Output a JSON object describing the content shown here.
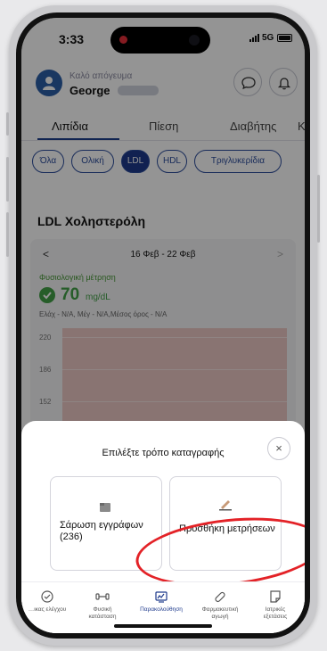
{
  "status_bar": {
    "time": "3:33",
    "network": "5G"
  },
  "header": {
    "greeting": "Καλό απόγευμα",
    "username": "George",
    "chat_icon": "chat-bubble-icon",
    "notifications_icon": "bell-icon"
  },
  "tabs": [
    {
      "label": "Λιπίδια",
      "active": true
    },
    {
      "label": "Πίεση",
      "active": false
    },
    {
      "label": "Διαβήτης",
      "active": false
    },
    {
      "label": "Κ",
      "active": false
    }
  ],
  "chips": [
    {
      "label": "Όλα",
      "active": false
    },
    {
      "label": "Ολική",
      "active": false
    },
    {
      "label": "LDL",
      "active": true
    },
    {
      "label": "HDL",
      "active": false
    },
    {
      "label": "Τριγλυκερίδια",
      "active": false
    }
  ],
  "section_title": "LDL Χοληστερόλη",
  "chart_card": {
    "prev": "<",
    "next": ">",
    "week_label": "16 Φεβ - 22 Φεβ",
    "status": "Φυσιολογική μέτρηση",
    "value": "70",
    "unit": "mg/dL",
    "stats": "Ελάχ - N/A, Μέγ - N/A,Μέσος όρος - N/A",
    "y_ticks": [
      "220",
      "186",
      "152"
    ]
  },
  "sheet": {
    "title": "Επιλέξτε τρόπο καταγραφής",
    "close": "×",
    "options": [
      {
        "label_line1": "Σάρωση εγγράφων",
        "label_line2": "(236)",
        "icon": "document-icon"
      },
      {
        "label_line1": "Προσθήκη μετρήσεων",
        "icon": "pencil-icon"
      }
    ]
  },
  "bottom_nav": [
    {
      "label_line1": "…ικας ελέγχου",
      "label_line2": "",
      "icon": "checklist-icon",
      "active": false
    },
    {
      "label_line1": "Φυσική",
      "label_line2": "κατάσταση",
      "icon": "dumbbell-icon",
      "active": false
    },
    {
      "label_line1": "Παρακολούθηση",
      "label_line2": "",
      "icon": "monitor-icon",
      "active": true
    },
    {
      "label_line1": "Φαρμακευτική",
      "label_line2": "αγωγή",
      "icon": "pill-icon",
      "active": false
    },
    {
      "label_line1": "Ιατρικές",
      "label_line2": "εξετάσεις",
      "icon": "document-icon",
      "active": false
    }
  ],
  "colors": {
    "brand": "#1e3a8c",
    "normal_status": "#43a047",
    "annotation": "#e32227"
  }
}
